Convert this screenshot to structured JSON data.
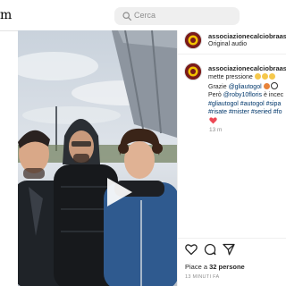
{
  "header": {
    "logo_fragment": "m",
    "search_placeholder": "Cerca"
  },
  "post": {
    "username": "associazionecalciobraasd",
    "audio": "Original audio",
    "caption": {
      "username": "associazionecalciobraasd",
      "line1": "mette pressione",
      "line2_prefix": "Grazie ",
      "line2_mention": "@gliautogol",
      "line3_prefix": "Però ",
      "line3_mention": "@roby10floris",
      "line3_suffix": " è incec",
      "line4_tags": "#gliautogol #autogol #sipa",
      "line5_tags": "#risate #mister #seried #fo"
    },
    "comment_time": "13 m",
    "likes_prefix": "Piace a ",
    "likes_count": "32 persone",
    "time_ago": "13 MINUTI FA"
  },
  "colors": {
    "link": "#00376b",
    "heart": "#ed4956",
    "club_maroon": "#7a1b1b",
    "club_yellow": "#f2c200"
  },
  "icons": {
    "search": "search-icon",
    "play": "play-icon",
    "like": "heart-outline-icon",
    "comment": "comment-icon",
    "share": "share-icon"
  }
}
